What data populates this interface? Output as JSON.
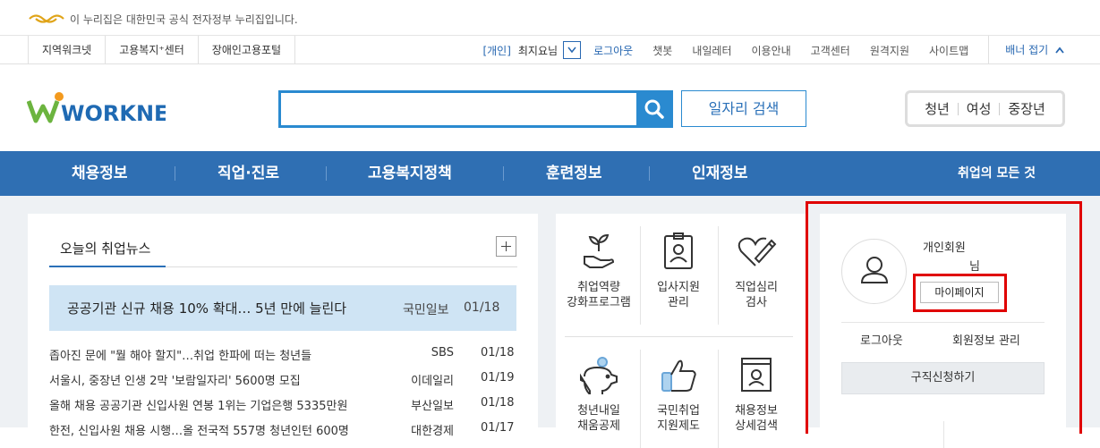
{
  "gov_banner": {
    "text": "이 누리집은 대한민국 공식 전자정부 누리집입니다."
  },
  "util_left": [
    "지역워크넷",
    "고용복지⁺센터",
    "장애인고용포털"
  ],
  "util_right": {
    "tag": "[개인]",
    "user": "최지요님",
    "links": [
      "로그아웃",
      "챗봇",
      "내일레터",
      "이용안내",
      "고객센터",
      "원격지원",
      "사이트맵"
    ],
    "fold": "배너 접기"
  },
  "header": {
    "logo_text": "WORKNET",
    "search_placeholder": "",
    "job_search": "일자리 검색",
    "targets": [
      "청년",
      "여성",
      "중장년"
    ]
  },
  "gnb": {
    "items": [
      "채용정보",
      "직업·진로",
      "고용복지정책",
      "훈련정보",
      "인재정보"
    ],
    "right": "취업의 모든 것"
  },
  "news": {
    "tab": "오늘의 취업뉴스",
    "headline": {
      "title": "공공기관 신규 채용 10% 확대… 5년 만에 늘린다",
      "source": "국민일보",
      "date": "01/18"
    },
    "rows": [
      {
        "title": "좁아진 문에 \"뭘 해야 할지\"…취업 한파에 떠는 청년들",
        "source": "SBS",
        "date": "01/18"
      },
      {
        "title": "서울시, 중장년 인생 2막 '보람일자리' 5600명 모집",
        "source": "이데일리",
        "date": "01/19"
      },
      {
        "title": "올해 채용 공공기관 신입사원 연봉 1위는 기업은행 5335만원",
        "source": "부산일보",
        "date": "01/18"
      },
      {
        "title": "한전, 신입사원 채용 시행…올 전국적 557명 청년인턴 600명",
        "source": "대한경제",
        "date": "01/17"
      }
    ]
  },
  "services": [
    {
      "label1": "취업역량",
      "label2": "강화프로그램",
      "icon": "plant-hand-icon"
    },
    {
      "label1": "입사지원",
      "label2": "관리",
      "icon": "id-card-icon"
    },
    {
      "label1": "직업심리",
      "label2": "검사",
      "icon": "heart-pencil-icon"
    },
    {
      "label1": "청년내일",
      "label2": "채움공제",
      "icon": "piggy-bank-icon"
    },
    {
      "label1": "국민취업",
      "label2": "지원제도",
      "icon": "thumbs-up-icon"
    },
    {
      "label1": "채용정보",
      "label2": "상세검색",
      "icon": "document-search-icon"
    }
  ],
  "user": {
    "type": "개인회원",
    "name_suffix": "님",
    "mypage": "마이페이지",
    "logout": "로그아웃",
    "member": "회원정보 관리",
    "apply": "구직신청하기"
  },
  "colors": {
    "primary": "#2f6fb3",
    "search": "#2a8ad0",
    "highlight": "#e00000"
  }
}
